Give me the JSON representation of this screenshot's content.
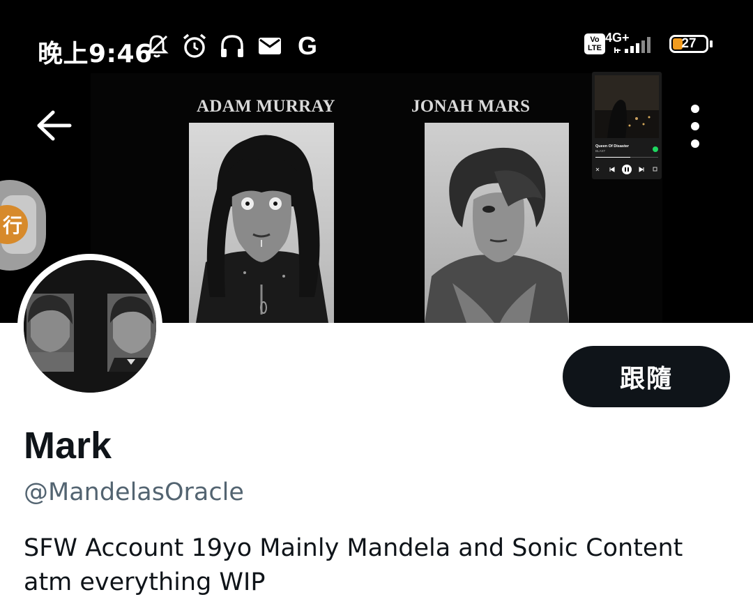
{
  "status_bar": {
    "time": "晚上9:46",
    "left_icons": [
      "bell-off-icon",
      "alarm-icon",
      "headphones-icon",
      "mail-icon",
      "google-icon"
    ],
    "google_letter": "G",
    "volte": "Vo LTE",
    "network": "4G+",
    "battery_percent": "27"
  },
  "header": {
    "back_icon": "back-arrow-icon",
    "more_icon": "more-vertical-icon"
  },
  "banner": {
    "character_1_name": "ADAM MURRAY",
    "character_2_name": "JONAH MARS",
    "music_widget": {
      "song_title": "Queen Of Disaster",
      "artist": "BLAST"
    }
  },
  "floating_bubble": {
    "glyph": "行"
  },
  "profile": {
    "follow_label": "跟隨",
    "display_name": "Mark",
    "handle": "@MandelasOracle",
    "bio_line_1": "SFW Account 19yo Mainly Mandela and Sonic Content",
    "bio_line_2": "atm everything WIP"
  },
  "colors": {
    "primary_text": "#0f1419",
    "secondary_text": "#536471",
    "follow_button_bg": "#0f1419",
    "battery_fill": "#f29c1f"
  }
}
